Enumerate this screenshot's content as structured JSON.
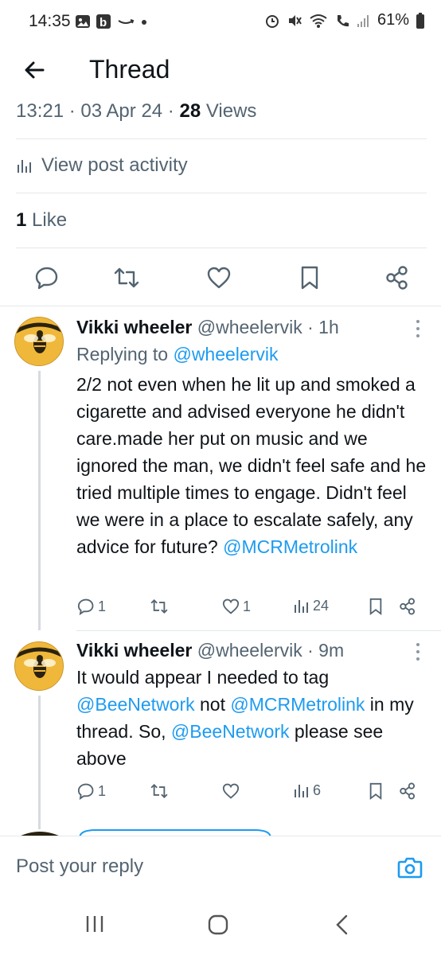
{
  "status_bar": {
    "time": "14:35",
    "battery": "61%"
  },
  "header": {
    "title": "Thread"
  },
  "post_meta": {
    "time_date": "13:21 · 03 Apr 24 · ",
    "views_count": "28",
    "views_label": " Views"
  },
  "activity": {
    "label": "View post activity"
  },
  "likes": {
    "count": "1",
    "label": " Like"
  },
  "replies": [
    {
      "name": "Vikki wheeler",
      "handle": "@wheelervik · 1h",
      "replying_prefix": "Replying to ",
      "replying_handle": "@wheelervik",
      "text": "2/2 not even when he lit up and smoked a cigarette and advised everyone he didn't care.made her put on music and we ignored the man, we didn't feel safe and he tried multiple times to engage. Didn't feel we were in a place to escalate safely, any advice for future? ",
      "mention": "@MCRMetrolink",
      "reply_count": "1",
      "retweet_count": "",
      "like_count": "1",
      "view_count": "24"
    },
    {
      "name": "Vikki wheeler",
      "handle": "@wheelervik · 9m",
      "text_1": "It would appear I needed to tag ",
      "mention_1": "@BeeNetwork",
      "text_2": " not ",
      "mention_2": "@MCRMetrolink",
      "text_3": " in my thread. So,  ",
      "mention_3": "@BeeNetwork",
      "text_4": " please see above",
      "reply_count": "1",
      "retweet_count": "",
      "like_count": "",
      "view_count": "6"
    }
  ],
  "composer": {
    "placeholder": "Post your reply"
  },
  "colors": {
    "link": "#1d9bf0",
    "muted": "#536471",
    "text": "#0f1419"
  },
  "icons": [
    "back-arrow-icon",
    "reply-icon",
    "retweet-icon",
    "like-icon",
    "bookmark-icon",
    "share-icon",
    "analytics-icon",
    "more-icon",
    "camera-icon"
  ]
}
